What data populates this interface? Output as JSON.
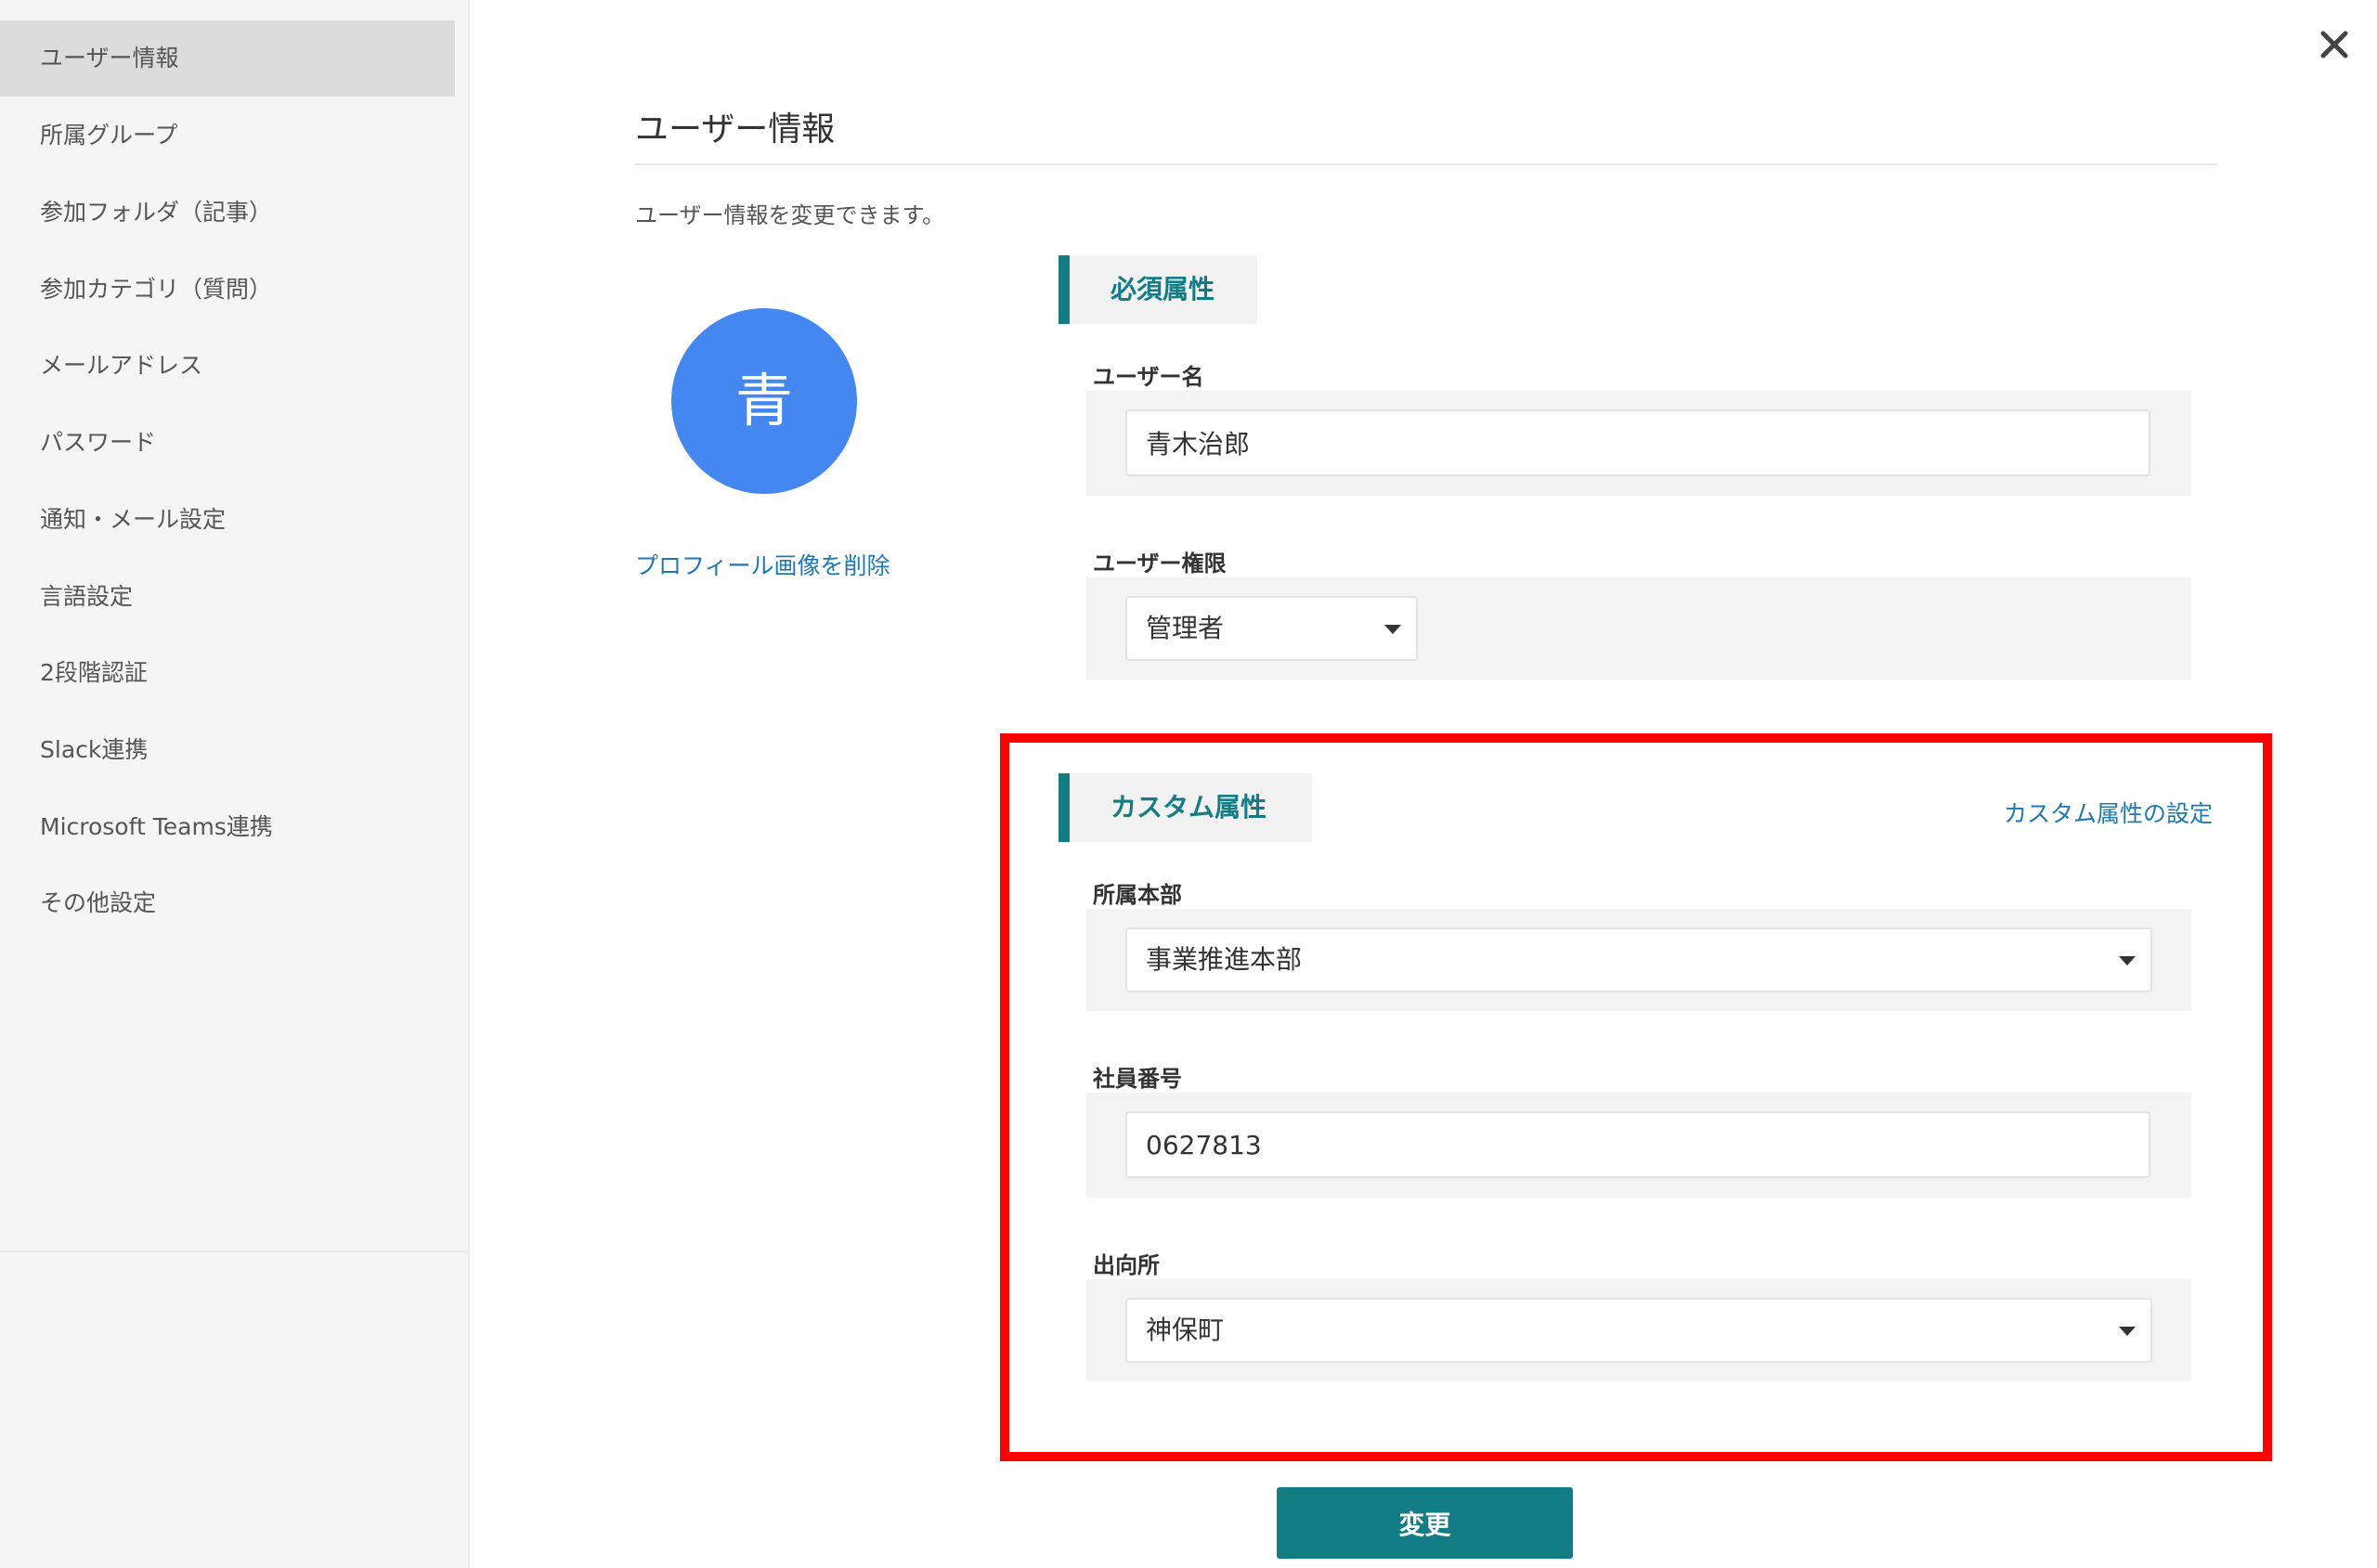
{
  "sidebar": {
    "items": [
      {
        "label": "ユーザー情報"
      },
      {
        "label": "所属グループ"
      },
      {
        "label": "参加フォルダ（記事）"
      },
      {
        "label": "参加カテゴリ（質問）"
      },
      {
        "label": "メールアドレス"
      },
      {
        "label": "パスワード"
      },
      {
        "label": "通知・メール設定"
      },
      {
        "label": "言語設定"
      },
      {
        "label": "2段階認証"
      },
      {
        "label": "Slack連携"
      },
      {
        "label": "Microsoft Teams連携"
      },
      {
        "label": "その他設定"
      }
    ],
    "active_index": 0
  },
  "header": {
    "title": "ユーザー情報",
    "description": "ユーザー情報を変更できます。"
  },
  "profile": {
    "avatar_initial": "青",
    "avatar_color": "#4487f1",
    "delete_image_link": "プロフィール画像を削除"
  },
  "required_section": {
    "title": "必須属性",
    "username_label": "ユーザー名",
    "username_value": "青木治郎",
    "role_label": "ユーザー権限",
    "role_value": "管理者"
  },
  "custom_section": {
    "title": "カスタム属性",
    "settings_link": "カスタム属性の設定",
    "department_label": "所属本部",
    "department_value": "事業推進本部",
    "employee_number_label": "社員番号",
    "employee_number_value": "0627813",
    "assignment_label": "出向所",
    "assignment_value": "神保町"
  },
  "actions": {
    "submit_label": "変更"
  },
  "colors": {
    "accent": "#137d86",
    "link": "#1f78b4",
    "highlight": "#ff0000"
  }
}
